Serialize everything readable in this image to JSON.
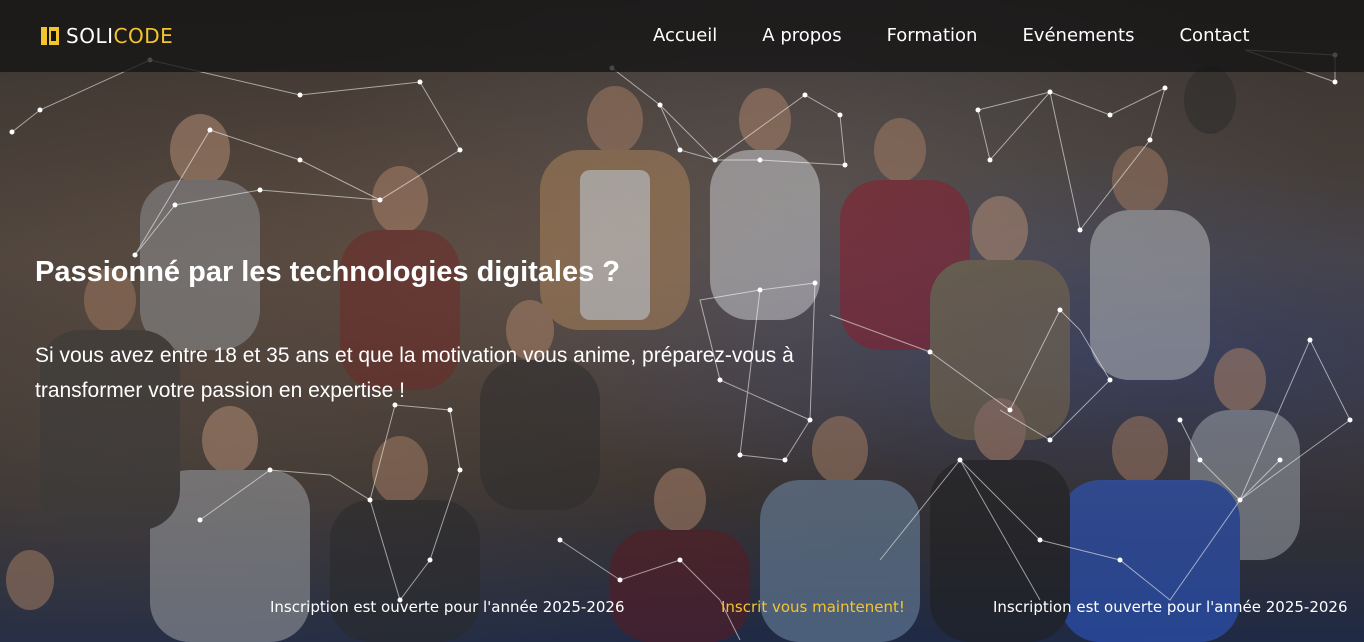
{
  "brand": {
    "name_accent": "SOLI",
    "name_rest": "CODE",
    "accent_color": "#f4c430"
  },
  "nav": {
    "items": [
      {
        "label": "Accueil"
      },
      {
        "label": "A propos"
      },
      {
        "label": "Formation"
      },
      {
        "label": "Evénements"
      },
      {
        "label": "Contact"
      }
    ]
  },
  "hero": {
    "headline": "Passionné par les technologies digitales ?",
    "lead": "Si vous avez entre 18 et 35 ans et que la motivation vous anime, préparez-vous à transformer votre passion en expertise !",
    "background_icon": "photo-crowd-background"
  },
  "ticker": {
    "items": [
      {
        "text": "Inscription est ouverte pour l'année 2025-2026"
      },
      {
        "text": "Inscrit vous maintenent!",
        "color": "#f4c430"
      },
      {
        "text": "Inscription est ouverte pour l'année 2025-2026"
      }
    ]
  }
}
